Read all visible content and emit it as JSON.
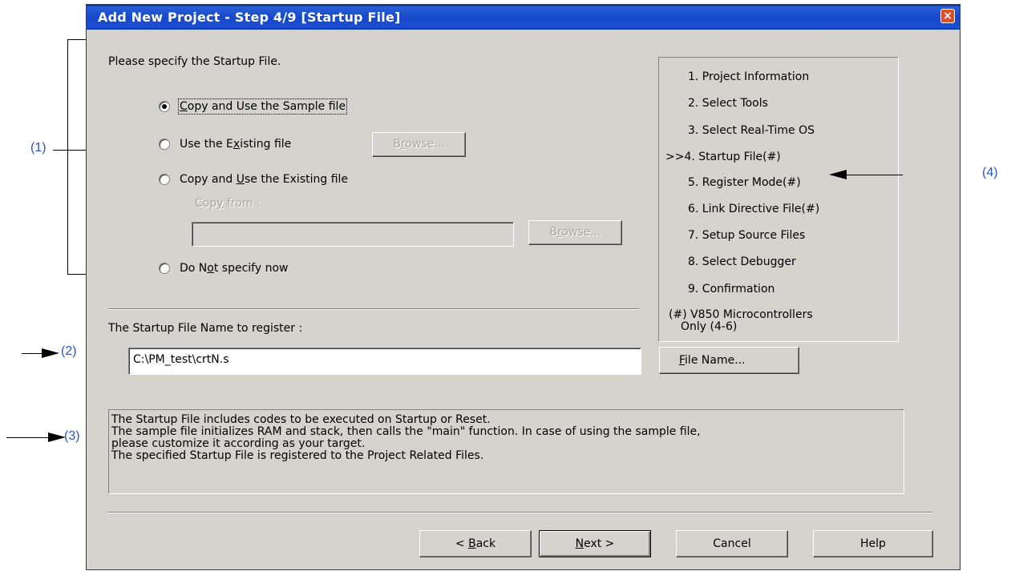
{
  "annotations": {
    "a1": "(1)",
    "a2": "(2)",
    "a3": "(3)",
    "a4": "(4)"
  },
  "window": {
    "title": "Add New Project - Step 4/9 [Startup File]",
    "close": "×"
  },
  "prompt": "Please specify the Startup File.",
  "options": {
    "copy_sample": {
      "pre": "",
      "key": "C",
      "post": "opy and Use the Sample file",
      "checked": true
    },
    "use_existing": {
      "pre": "Use the E",
      "key": "x",
      "post": "isting file",
      "checked": false
    },
    "copy_existing": {
      "pre": "Copy and ",
      "key": "U",
      "post": "se the Existing file",
      "checked": false
    },
    "do_not": {
      "pre": "Do N",
      "key": "o",
      "post": "t specify now",
      "checked": false
    }
  },
  "copy_from": {
    "pre": "Cop",
    "key": "y",
    "post": " from :",
    "value": ""
  },
  "browse1": {
    "pre": "B",
    "key": "r",
    "post": "owse..."
  },
  "browse2": {
    "pre": "B",
    "key": "r",
    "post": "owse..."
  },
  "startup_name_label": "The Startup File Name to register :",
  "startup_name_value": "C:\\PM_test\\crtN.s",
  "file_name_button": {
    "key": "F",
    "post": "ile Name..."
  },
  "steps": [
    "1. Project Information",
    "2. Select Tools",
    "3. Select Real-Time OS",
    ">>4. Startup File(#)",
    "5. Register Mode(#)",
    "6. Link Directive File(#)",
    "7. Setup Source Files",
    "8. Select Debugger",
    "9. Confirmation"
  ],
  "steps_note": [
    "(#) V850 Microcontrollers",
    "Only (4-6)"
  ],
  "description": [
    "The Startup File includes codes to be executed on Startup or Reset.",
    "The sample file initializes RAM and stack, then calls the \"main\" function. In case of using the sample file,",
    "please customize it according as your target.",
    "The specified Startup File is registered to the Project Related Files."
  ],
  "buttons": {
    "back": {
      "pre": "< ",
      "key": "B",
      "post": "ack"
    },
    "next": {
      "pre": "",
      "key": "N",
      "post": "ext >"
    },
    "cancel": "Cancel",
    "help": "Help"
  }
}
